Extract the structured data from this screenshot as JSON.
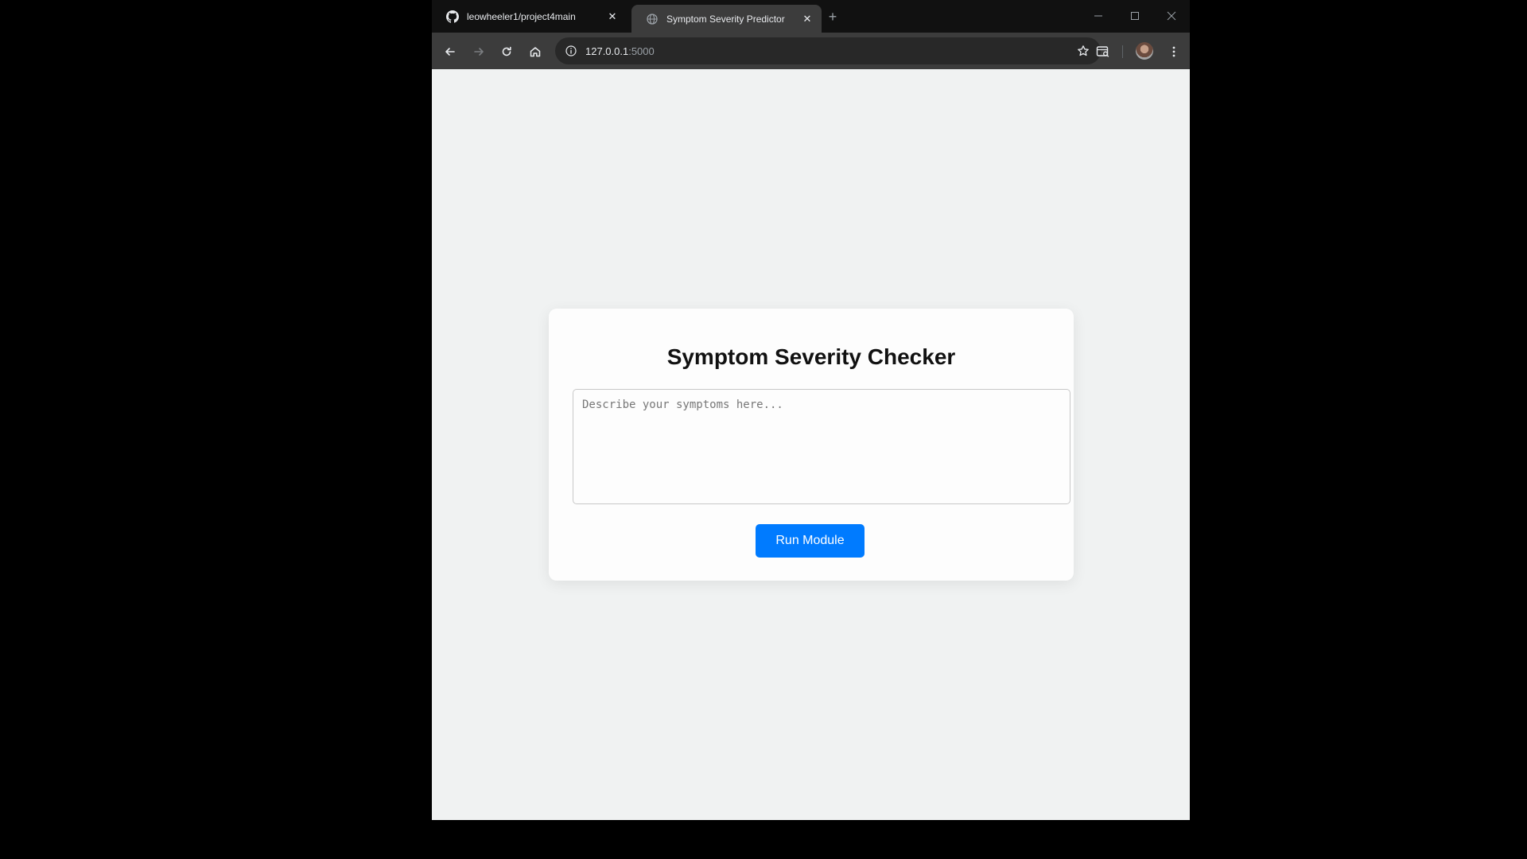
{
  "browser": {
    "tabs": [
      {
        "title": "leowheeler1/project4main",
        "icon": "github-icon"
      },
      {
        "title": "Symptom Severity Predictor",
        "icon": "globe-icon"
      }
    ],
    "url": {
      "host": "127.0.0.1",
      "port": ":5000"
    }
  },
  "page": {
    "title": "Symptom Severity Checker",
    "symptoms_placeholder": "Describe your symptoms here...",
    "symptoms_value": "",
    "run_button_label": "Run Module"
  },
  "colors": {
    "accent": "#007bff",
    "page_background": "#f0f2f2",
    "card_background": "#fdfdfd"
  }
}
